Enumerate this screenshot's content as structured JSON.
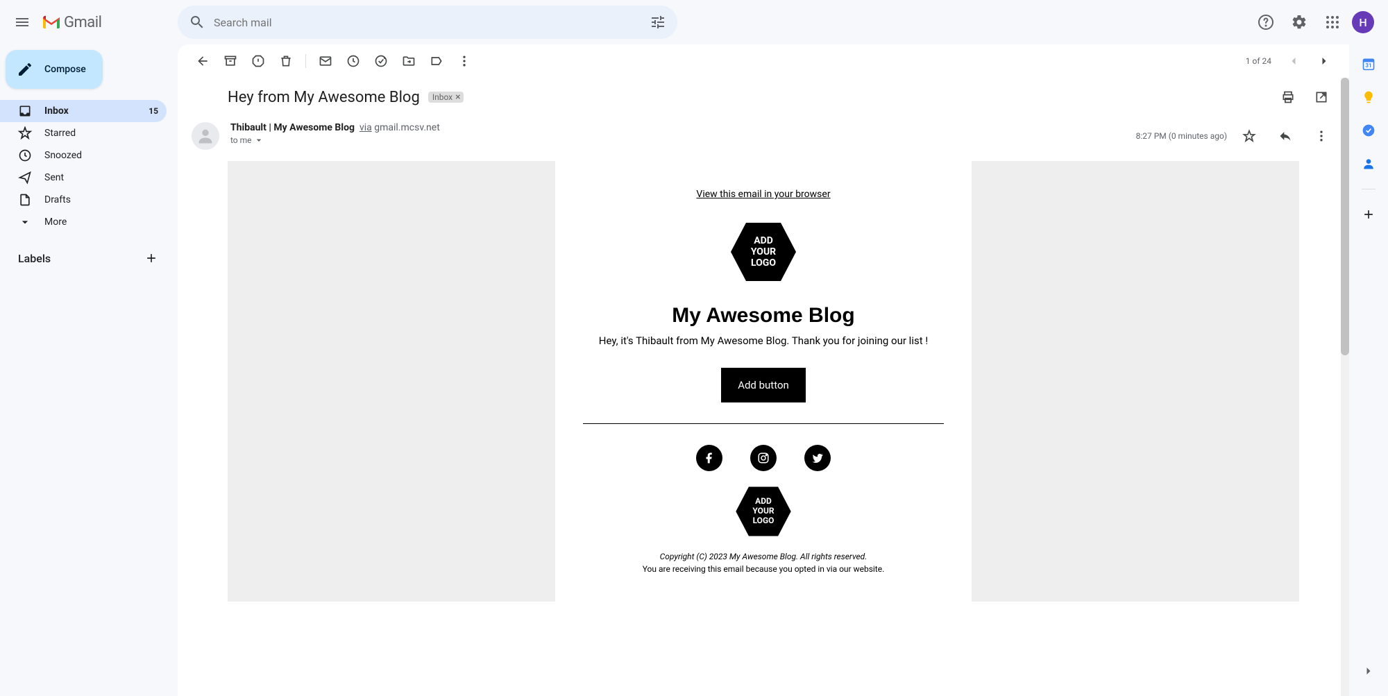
{
  "header": {
    "app_name": "Gmail",
    "search_placeholder": "Search mail",
    "avatar_initial": "H"
  },
  "compose_label": "Compose",
  "nav": {
    "inbox": "Inbox",
    "inbox_count": "15",
    "starred": "Starred",
    "snoozed": "Snoozed",
    "sent": "Sent",
    "drafts": "Drafts",
    "more": "More"
  },
  "labels_title": "Labels",
  "pagination": "1 of 24",
  "subject": "Hey from My Awesome Blog",
  "label_chip": "Inbox",
  "sender": {
    "name": "Thibault | My Awesome Blog",
    "via_word": "via",
    "via_domain": "gmail.mcsv.net",
    "to_line": "to me"
  },
  "timestamp": "8:27 PM (0 minutes ago)",
  "email": {
    "view_in_browser": "View this email in your browser",
    "logo_text_1": "ADD",
    "logo_text_2": "YOUR",
    "logo_text_3": "LOGO",
    "title": "My Awesome Blog",
    "intro": "Hey, it's Thibault from My Awesome Blog. Thank you for joining our list !",
    "button": "Add button",
    "copyright": "Copyright (C) 2023 My Awesome Blog. All rights reserved.",
    "optin": "You are receiving this email because you opted in via our website."
  }
}
